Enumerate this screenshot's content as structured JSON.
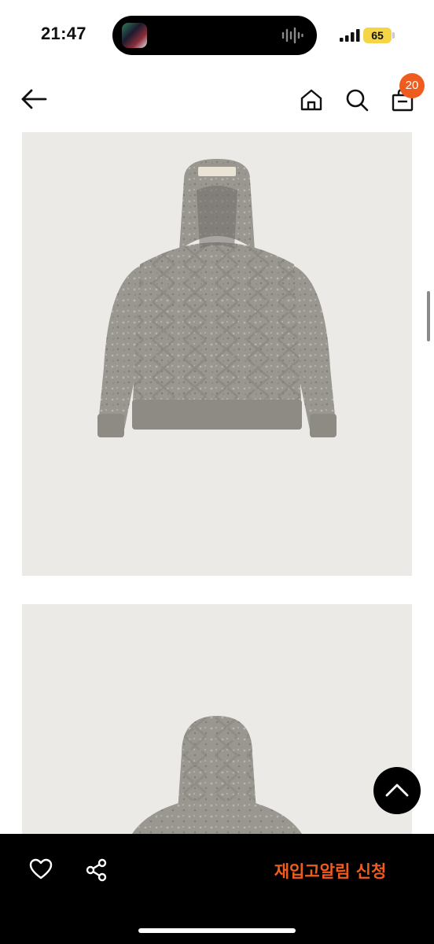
{
  "status_bar": {
    "time": "21:47",
    "battery": "65"
  },
  "header": {
    "back_icon": "arrow-left-icon",
    "home_icon": "home-icon",
    "search_icon": "search-icon",
    "cart_icon": "shopping-bag-icon",
    "cart_count": "20",
    "badge_color": "#ef5c1f"
  },
  "gallery": {
    "images": [
      {
        "subject": "grey cable-knit hooded sweater, front view"
      },
      {
        "subject": "grey cable-knit hooded sweater, back view"
      }
    ]
  },
  "scroll_top_button": {
    "icon": "chevron-up-icon"
  },
  "bottom_bar": {
    "like_icon": "heart-icon",
    "share_icon": "share-icon",
    "restock_label": "재입고알림 신청",
    "accent_color": "#ef5c1f"
  }
}
